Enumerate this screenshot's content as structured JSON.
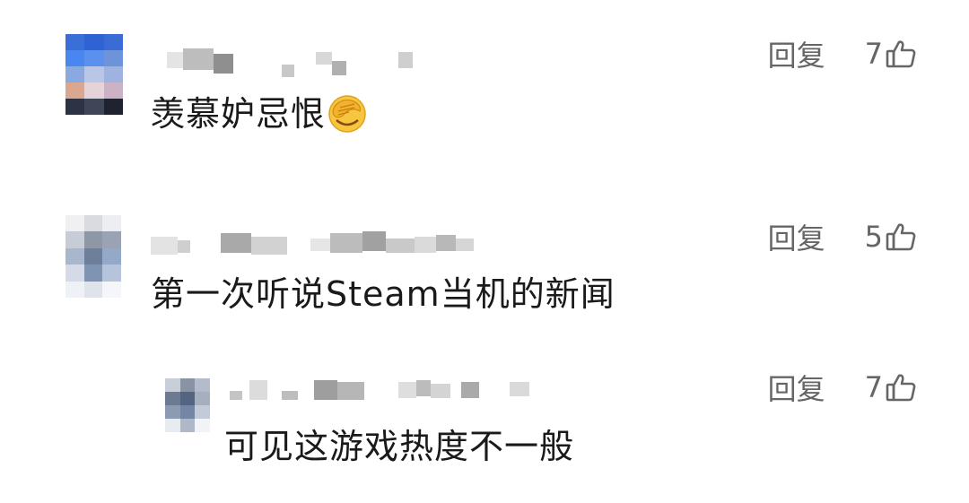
{
  "comments": [
    {
      "text": "羡慕妒忌恨",
      "emoji": "facepalm-emoji",
      "reply_label": "回复",
      "like_count": "7"
    },
    {
      "text": "第一次听说Steam当机的新闻",
      "reply_label": "回复",
      "like_count": "5"
    },
    {
      "text": "可见这游戏热度不一般",
      "reply_label": "回复",
      "like_count": "7"
    }
  ],
  "icons": {
    "like": "thumbs-up-icon"
  },
  "colors": {
    "text": "#1a1a1a",
    "secondary": "#666666",
    "background": "#ffffff"
  }
}
